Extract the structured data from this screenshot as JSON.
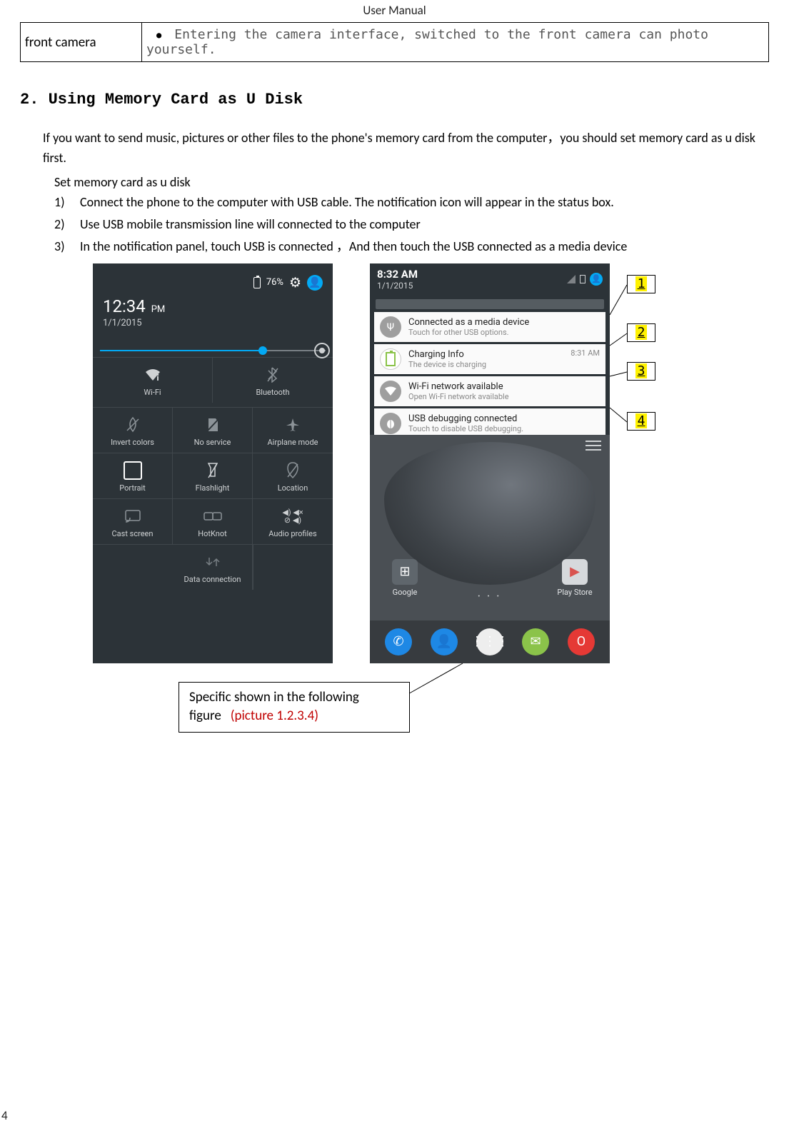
{
  "header": {
    "title": "User    Manual"
  },
  "table_row": {
    "left": "front camera",
    "right": "Entering the camera interface, switched to the front camera can photo yourself."
  },
  "section": {
    "heading": "2. Using Memory Card as U Disk"
  },
  "intro": "If you want to send music, pictures or other files to the phone's memory card from the computer，you should set memory card as u disk first.",
  "sub_head": "Set memory card as u disk",
  "steps": {
    "n1": "1)",
    "t1": "Connect the phone to the computer with USB cable. The notification icon will appear in the status box.",
    "n2": "2)",
    "t2": "Use USB mobile transmission line will connected to the computer",
    "n3": "3)",
    "t3": "In the notification panel, touch USB is connected  ，And then touch the USB connected as a media device"
  },
  "phone_left": {
    "battery_pct": "76%",
    "time": "12:34",
    "pm": "PM",
    "date": "1/1/2015",
    "tiles": {
      "wifi": "Wi-Fi",
      "bt": "Bluetooth",
      "invert": "Invert colors",
      "noservice": "No service",
      "airplane": "Airplane mode",
      "portrait": "Portrait",
      "flash": "Flashlight",
      "location": "Location",
      "cast": "Cast screen",
      "hotknot": "HotKnot",
      "audio": "Audio profiles",
      "data": "Data connection"
    }
  },
  "phone_right": {
    "time": "8:32 AM",
    "date": "1/1/2015",
    "notifs": {
      "n1t": "Connected as a media device",
      "n1s": "Touch for other USB options.",
      "n2t": "Charging Info",
      "n2s": "The device is charging",
      "n2time": "8:31 AM",
      "n3t": "Wi-Fi network available",
      "n3s": "Open Wi-Fi network available",
      "n4t": "USB debugging connected",
      "n4s": "Touch to disable USB debugging."
    },
    "apps": {
      "google": "Google",
      "play": "Play Store"
    }
  },
  "callouts": {
    "c1": "1",
    "c2": "2",
    "c3": "3",
    "c4": "4"
  },
  "caption": {
    "line1": "Specific shown in the following",
    "line2a": "figure",
    "line2b": "(picture 1.2.3.4)"
  },
  "page_number": "4"
}
